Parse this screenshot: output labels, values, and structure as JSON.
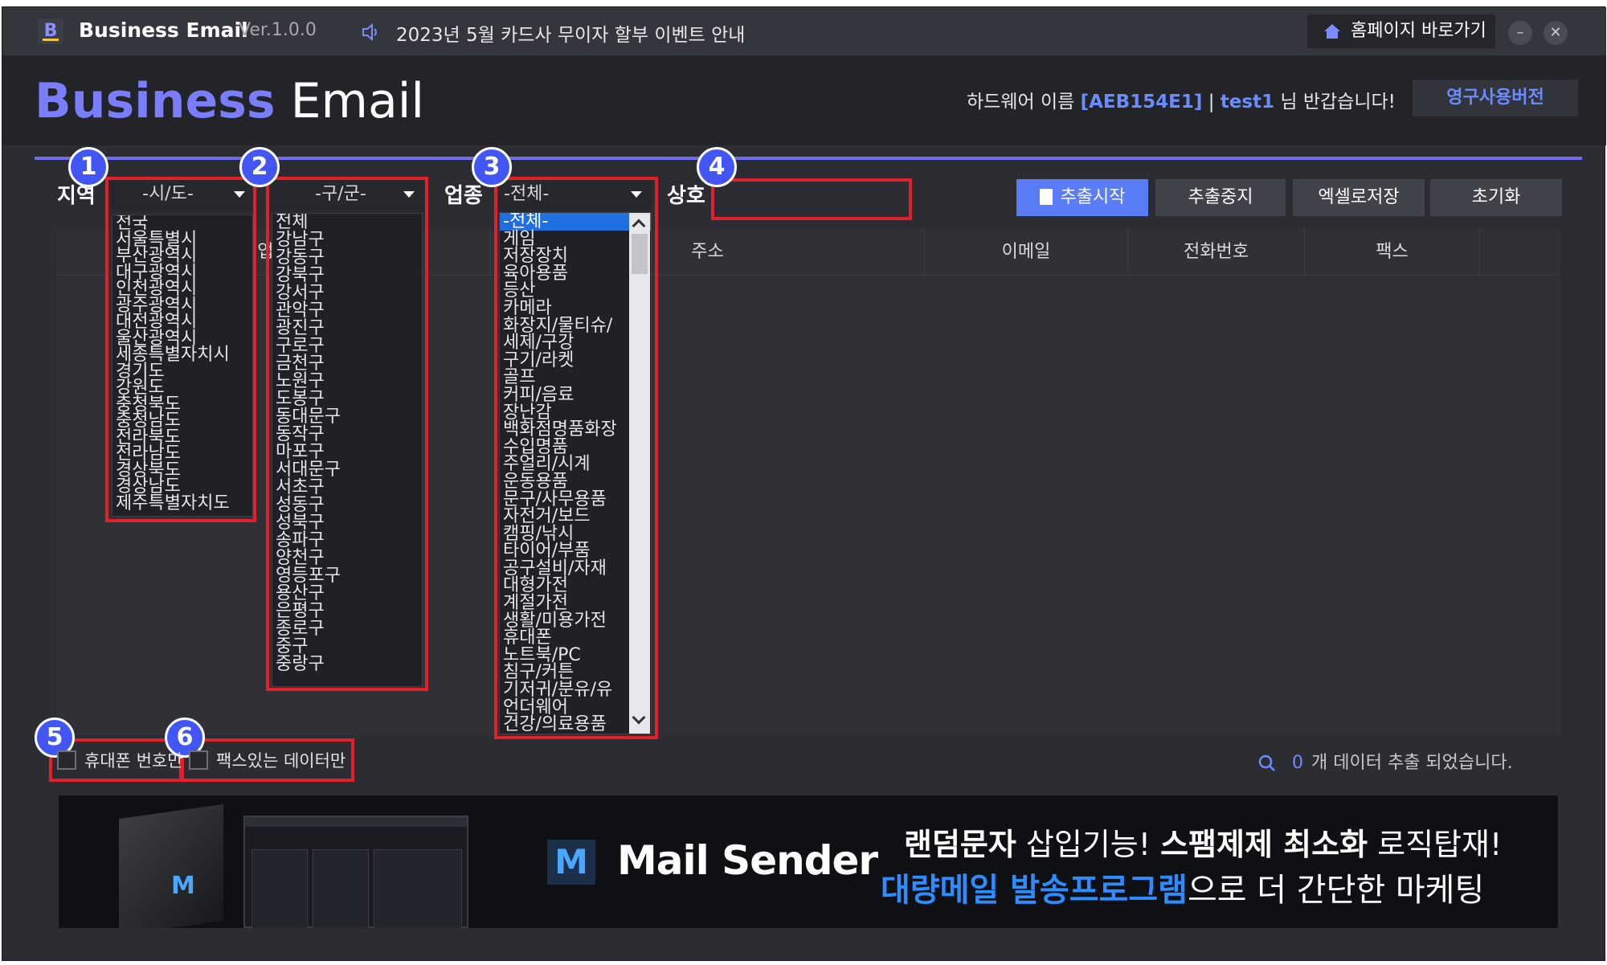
{
  "titlebar": {
    "app_icon_letter": "B",
    "app_name": "Business Email",
    "version": "Ver.1.0.0",
    "notice": "2023년 5월 카드사 무이자 할부 이벤트 안내",
    "homepage_button": "홈페이지 바로가기",
    "minimize": "–",
    "close": "✕"
  },
  "header": {
    "logo_bold": "Business",
    "logo_regular": "Email",
    "hw_label": "하드웨어 이름",
    "hw_id": "[AEB154E1]",
    "separator": "|",
    "user": "test1",
    "greeting_suffix": "님 반갑습니다!",
    "permanent_button": "영구사용버전"
  },
  "filters": {
    "region_label": "지역",
    "city_select": "-시/도-",
    "district_select": "-구/군-",
    "industry_label": "업종",
    "industry_select": "-전체-",
    "company_label": "상호",
    "company_value": ""
  },
  "city_options": [
    "전국",
    "서울특별시",
    "부산광역시",
    "대구광역시",
    "인천광역시",
    "광주광역시",
    "대전광역시",
    "울산광역시",
    "세종특별자치시",
    "경기도",
    "강원도",
    "충청북도",
    "충청남도",
    "전라북도",
    "전라남도",
    "경상북도",
    "경상남도",
    "제주특별자치도"
  ],
  "district_options": [
    "전체",
    "강남구",
    "강동구",
    "강북구",
    "강서구",
    "관악구",
    "광진구",
    "구로구",
    "금천구",
    "노원구",
    "도봉구",
    "동대문구",
    "동작구",
    "마포구",
    "서대문구",
    "서초구",
    "성동구",
    "성북구",
    "송파구",
    "양천구",
    "영등포구",
    "용산구",
    "은평구",
    "종로구",
    "중구",
    "중랑구"
  ],
  "industry_options": [
    "-전체-",
    "게임",
    "저장장치",
    "육아용품",
    "등산",
    "카메라",
    "화장지/물티슈/",
    "세제/구강",
    "구기/라켓",
    "골프",
    "커피/음료",
    "장난감",
    "백화점명품화장",
    "수입명품",
    "주얼리/시계",
    "운동용품",
    "문구/사무용품",
    "자전거/보드",
    "캠핑/낚시",
    "타이어/부품",
    "공구설비/자재",
    "대형가전",
    "계절가전",
    "생활/미용가전",
    "휴대폰",
    "노트북/PC",
    "침구/커튼",
    "기저귀/분유/유",
    "언더웨어",
    "건강/의료용품"
  ],
  "actions": {
    "start": "추출시작",
    "stop": "추출중지",
    "save_excel": "엑셀로저장",
    "reset": "초기화"
  },
  "table_headers": [
    "업종",
    "주소",
    "이메일",
    "전화번호",
    "팩스"
  ],
  "options": {
    "mobile_only": "휴대폰 번호만",
    "fax_only": "팩스있는 데이터만"
  },
  "status": {
    "count": "0",
    "message": "개 데이터 추출 되었습니다."
  },
  "badges": [
    "1",
    "2",
    "3",
    "4",
    "5",
    "6"
  ],
  "banner": {
    "box_letter": "M",
    "product_icon_letter": "M",
    "product_name": "Mail Sender",
    "line1_a": "랜덤문자",
    "line1_b": " 삽입기능! ",
    "line1_c": "스팸제제 최소화",
    "line1_d": " 로직탑재!",
    "line2_a": "대량메일 발송프로그램",
    "line2_b": "으로 더 간단한 마케팅"
  },
  "colors": {
    "accent": "#6f6cf2",
    "brand_blue": "#6a8cff",
    "badge": "#4255f5",
    "highlight_red": "#e2202a",
    "start_button": "#5b7cf7"
  }
}
